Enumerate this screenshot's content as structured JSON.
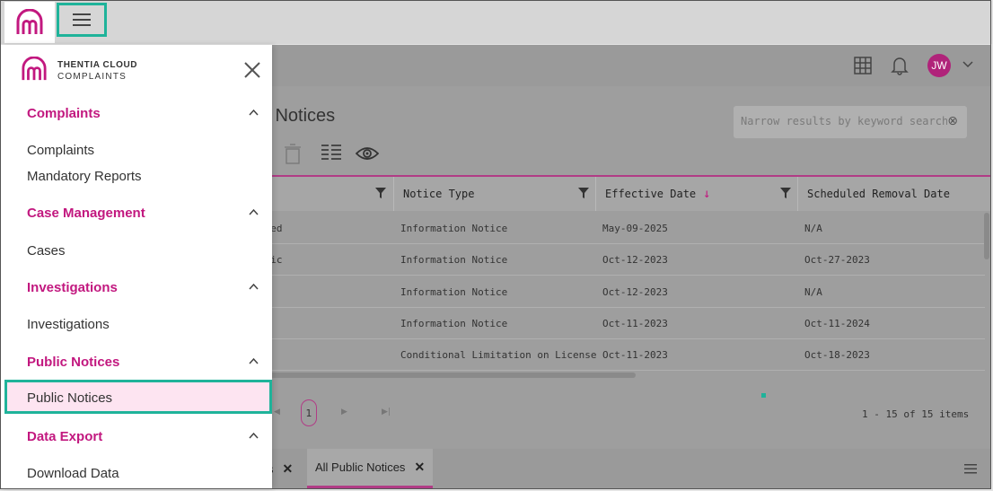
{
  "topbar": {
    "menu_button": "menu"
  },
  "drawer": {
    "brand_line1": "THENTIA CLOUD",
    "brand_line2": "COMPLAINTS",
    "sections": [
      {
        "label": "Complaints",
        "items": [
          "Complaints",
          "Mandatory Reports"
        ]
      },
      {
        "label": "Case Management",
        "items": [
          "Cases"
        ]
      },
      {
        "label": "Investigations",
        "items": [
          "Investigations"
        ]
      },
      {
        "label": "Public Notices",
        "items": [
          "Public Notices"
        ]
      },
      {
        "label": "Data Export",
        "items": [
          "Download Data"
        ]
      }
    ],
    "active_item": "Public Notices"
  },
  "header": {
    "avatar_initials": "JW"
  },
  "main": {
    "title_visible": "lic Notices",
    "search_placeholder": "Narrow results by keyword search",
    "columns": [
      {
        "label": "Notice Type"
      },
      {
        "label": "Effective Date"
      },
      {
        "label": "Scheduled Removal Date"
      }
    ],
    "rows": [
      {
        "col1": "ised",
        "type": "Information Notice",
        "effective": "May-09-2025",
        "removal": "N/A"
      },
      {
        "col1": "blic",
        "type": "Information Notice",
        "effective": "Oct-12-2023",
        "removal": "Oct-27-2023"
      },
      {
        "col1": "",
        "type": "Information Notice",
        "effective": "Oct-12-2023",
        "removal": "N/A"
      },
      {
        "col1": "",
        "type": "Information Notice",
        "effective": "Oct-11-2023",
        "removal": "Oct-11-2024"
      },
      {
        "col1": "",
        "type": "Conditional Limitation on License",
        "effective": "Oct-11-2023",
        "removal": "Oct-18-2023"
      }
    ],
    "page": "1",
    "pager_info": "1 - 15 of 15 items"
  },
  "bottom_tabs": {
    "tab1_partial": "s",
    "tab2": "All Public Notices"
  },
  "colors": {
    "accent": "#c2187f",
    "highlight": "#1fb39a",
    "active_bg": "#fde4f1"
  }
}
